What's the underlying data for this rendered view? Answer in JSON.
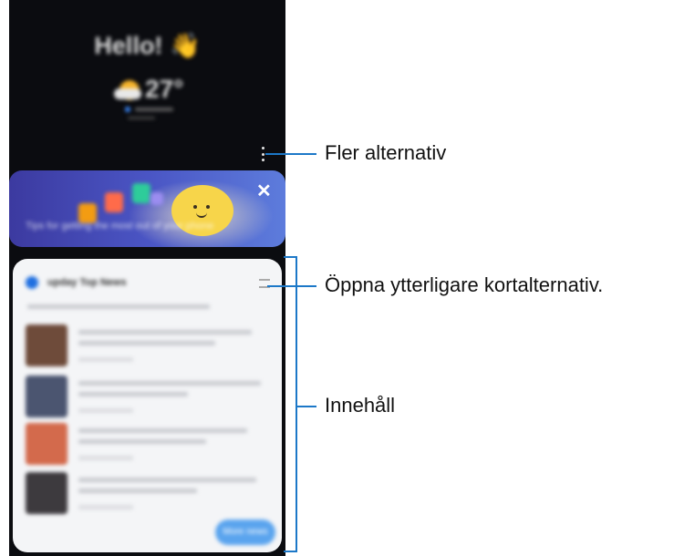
{
  "phone": {
    "greeting": "Hello!",
    "greeting_emoji": "👋",
    "weather": {
      "temperature": "27°"
    },
    "tips_card": {
      "text": "Tips for getting the most out of your phone",
      "close_icon": "close-icon"
    },
    "news_card": {
      "title": "upday Top News",
      "more_button": "More news"
    }
  },
  "callouts": {
    "more_options": "Fler alternativ",
    "card_options": "Öppna ytterligare kortalternativ.",
    "content": "Innehåll"
  },
  "colors": {
    "phone_bg": "#0b0c10",
    "accent": "#1c78c8",
    "tips_gradient_start": "#3c3aa0",
    "news_button": "#5aa4ee"
  }
}
